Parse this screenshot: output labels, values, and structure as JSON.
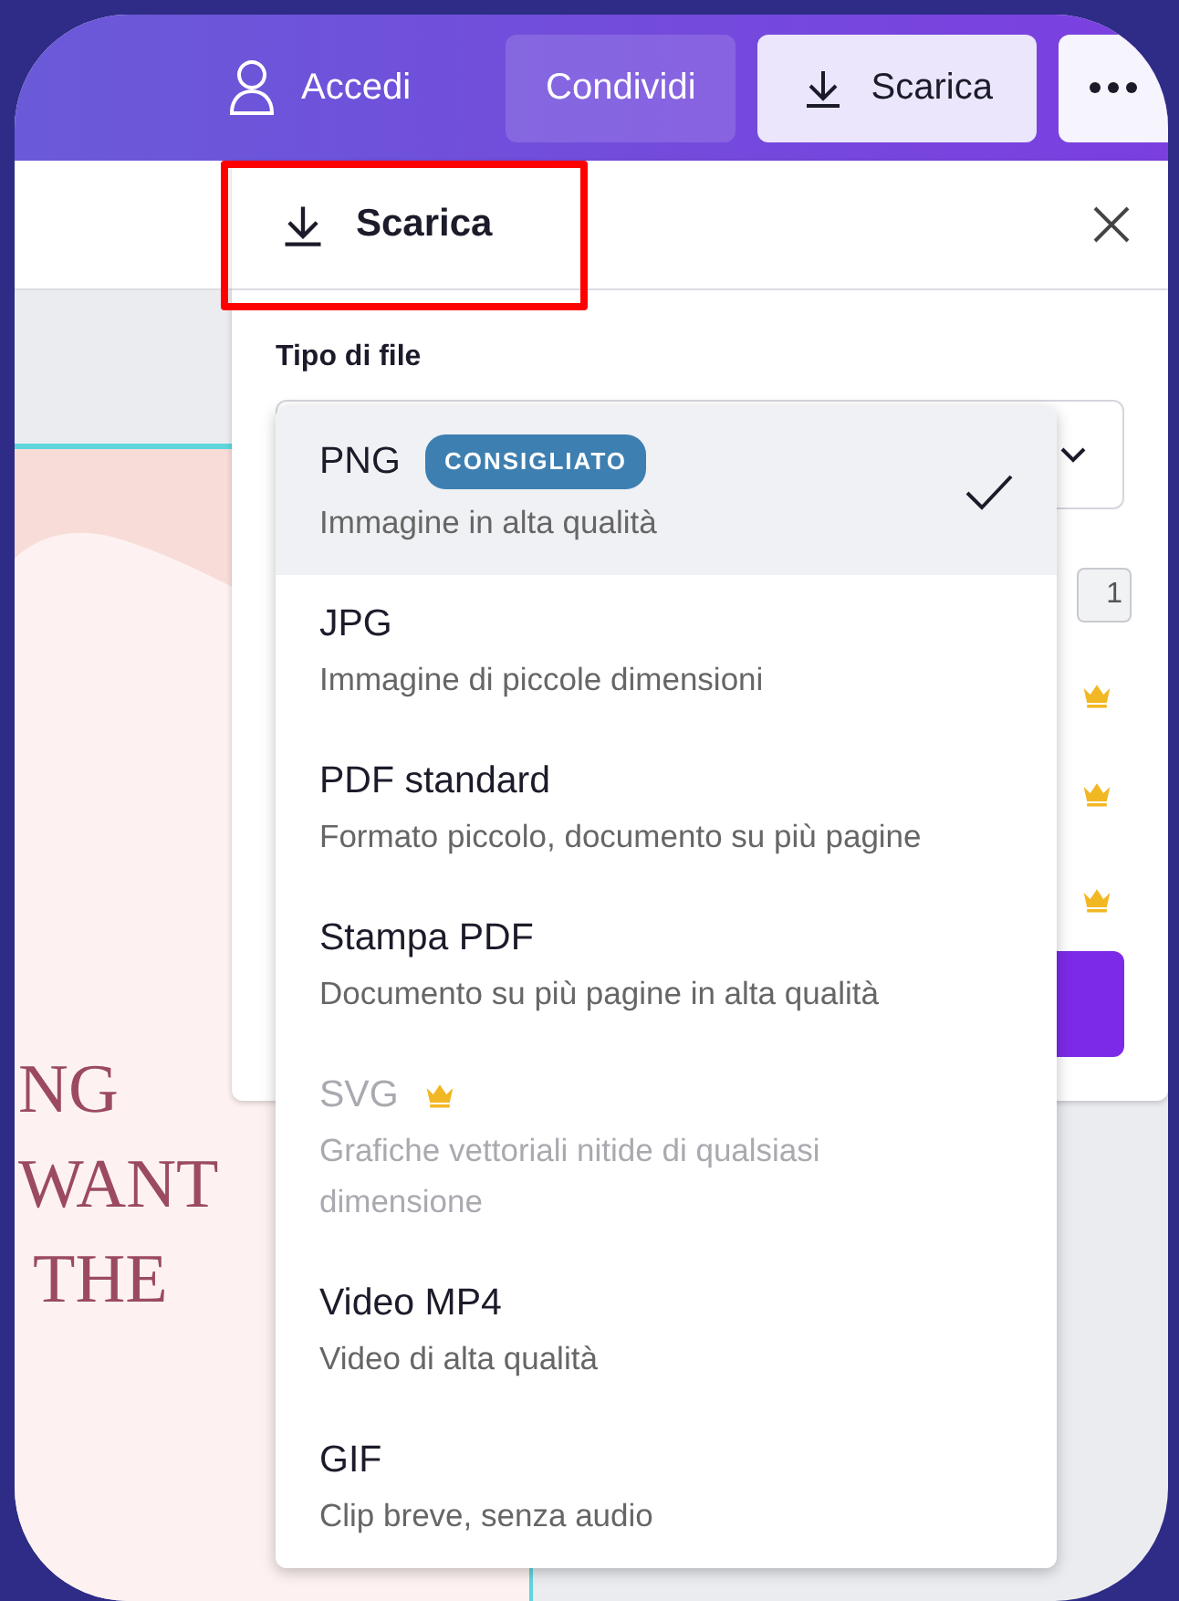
{
  "topbar": {
    "buttons": [
      {
        "kind": "account",
        "label": "Accedi"
      },
      {
        "kind": "share",
        "label": "Condividi"
      },
      {
        "kind": "download",
        "label": "Scarica"
      },
      {
        "kind": "more"
      }
    ]
  },
  "canvas": {
    "lines": [
      "NG",
      "WANT",
      "THE"
    ]
  },
  "panel": {
    "title": "Scarica",
    "highlighted": true,
    "file_type_label": "Tipo di file",
    "hidden_value": "1",
    "options": [
      {
        "name": "PNG",
        "description": "Immagine in alta qualità",
        "badge": "CONSIGLIATO",
        "selected": true,
        "disabled": false,
        "premium": false
      },
      {
        "name": "JPG",
        "description": "Immagine di piccole dimensioni",
        "selected": false,
        "disabled": false,
        "premium": false
      },
      {
        "name": "PDF standard",
        "description": "Formato piccolo, documento su più pagine",
        "selected": false,
        "disabled": false,
        "premium": false
      },
      {
        "name": "Stampa PDF",
        "description": "Documento su più pagine in alta qualità",
        "selected": false,
        "disabled": false,
        "premium": false
      },
      {
        "name": "SVG",
        "description": "Grafiche vettoriali nitide di qualsiasi dimensione",
        "selected": false,
        "disabled": true,
        "premium": true
      },
      {
        "name": "Video MP4",
        "description": "Video di alta qualità",
        "selected": false,
        "disabled": false,
        "premium": false
      },
      {
        "name": "GIF",
        "description": "Clip breve, senza audio",
        "selected": false,
        "disabled": false,
        "premium": false
      }
    ]
  }
}
